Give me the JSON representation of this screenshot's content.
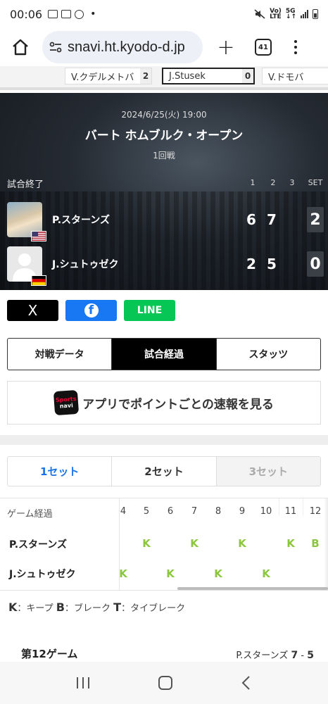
{
  "status_bar": {
    "time": "00:06",
    "dot": "•",
    "net_top": "Vo)",
    "net_bottom": "LTE",
    "net5g_top": "5G",
    "net5g_bottom": "↓↑"
  },
  "browser": {
    "url": "snavi.ht.kyodo-d.jp",
    "tab_count": "41"
  },
  "strip": {
    "chips": [
      {
        "name": "V.クデルメトバ",
        "score": "2"
      },
      {
        "name": "J.Stusek",
        "score": "0"
      },
      {
        "name": "V.ドモバ",
        "score": ""
      }
    ]
  },
  "match": {
    "date": "2024/6/25(火) 19:00",
    "event": "バート ホムブルク・オープン",
    "round": "1回戦",
    "status": "試合終了",
    "set_headers": [
      "1",
      "2",
      "3",
      "SET"
    ],
    "players": [
      {
        "name": "P.スターンズ",
        "games": [
          "6",
          "7"
        ],
        "sets": "2",
        "flag": "usa"
      },
      {
        "name": "J.シュトゥゼク",
        "games": [
          "2",
          "5"
        ],
        "sets": "0",
        "flag": "germany"
      }
    ]
  },
  "share": {
    "x": "X",
    "facebook": "f",
    "line": "LINE"
  },
  "view_tabs": [
    "対戦データ",
    "試合経過",
    "スタッツ"
  ],
  "app_banner": {
    "logo_top": "Sports",
    "logo_bottom": "navi",
    "text": "アプリでポイントごとの速報を見る"
  },
  "set_tabs": [
    "1セット",
    "2セット",
    "3セット"
  ],
  "game_table": {
    "header": "ゲーム経過",
    "game_numbers": [
      "4",
      "5",
      "6",
      "7",
      "8",
      "9",
      "10",
      "11",
      "12"
    ],
    "rows": [
      {
        "player": "P.スターンズ",
        "marks": [
          "",
          "K",
          "",
          "K",
          "",
          "K",
          "",
          "K",
          "B"
        ]
      },
      {
        "player": "J.シュトゥゼク",
        "marks": [
          "K",
          "",
          "K",
          "",
          "K",
          "",
          "K",
          "",
          ""
        ]
      }
    ]
  },
  "legend": [
    {
      "key": "K",
      "text": "：キープ"
    },
    {
      "key": "B",
      "text": "：ブレーク"
    },
    {
      "key": "T",
      "text": "：タイブレーク"
    }
  ],
  "current_game": {
    "title": "第12ゲーム",
    "player": "P.スターンズ",
    "score_a": "7",
    "sep": "-",
    "score_b": "5"
  },
  "colors": {
    "accent_blue": "#1a73e8",
    "keep_green": "#8cc63f",
    "facebook": "#1877f2",
    "line": "#06c755"
  }
}
